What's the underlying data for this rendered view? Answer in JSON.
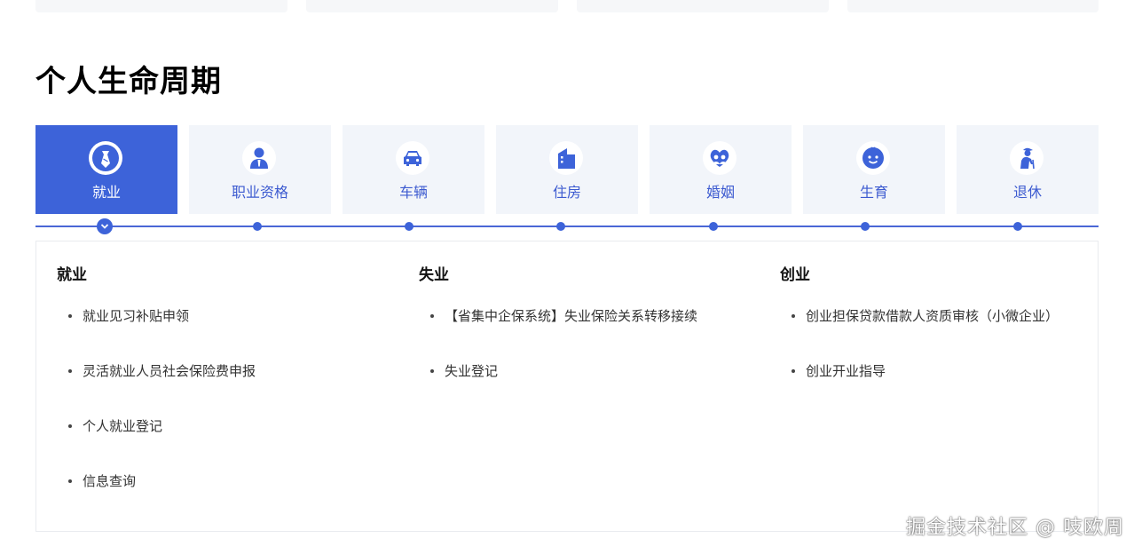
{
  "section": {
    "title": "个人生命周期"
  },
  "tabs": [
    {
      "label": "就业",
      "icon": "tie-icon",
      "active": true
    },
    {
      "label": "职业资格",
      "icon": "person-suit-icon",
      "active": false
    },
    {
      "label": "车辆",
      "icon": "car-icon",
      "active": false
    },
    {
      "label": "住房",
      "icon": "building-icon",
      "active": false
    },
    {
      "label": "婚姻",
      "icon": "couple-heart-icon",
      "active": false
    },
    {
      "label": "生育",
      "icon": "baby-icon",
      "active": false
    },
    {
      "label": "退休",
      "icon": "elder-icon",
      "active": false
    }
  ],
  "panel": {
    "columns": [
      {
        "title": "就业",
        "items": [
          "就业见习补贴申领",
          "灵活就业人员社会保险费申报",
          "个人就业登记",
          "信息查询"
        ]
      },
      {
        "title": "失业",
        "items": [
          "【省集中企保系统】失业保险关系转移接续",
          "失业登记"
        ]
      },
      {
        "title": "创业",
        "items": [
          "创业担保贷款借款人资质审核（小微企业）",
          "创业开业指导"
        ]
      }
    ]
  },
  "colors": {
    "accent": "#3d63d9",
    "tab_bg": "#f2f5fa",
    "tab_label": "#3c5ad0"
  },
  "watermark": "掘金技术社区 @ 吱欧周"
}
